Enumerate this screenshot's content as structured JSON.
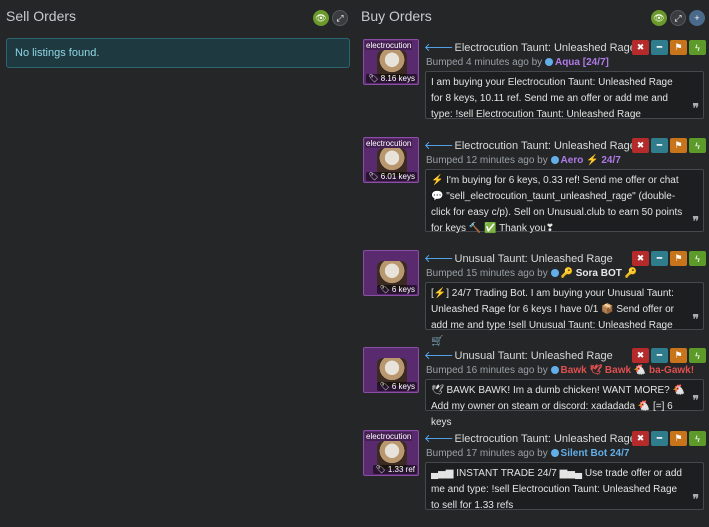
{
  "sell": {
    "title": "Sell Orders",
    "empty_message": "No listings found."
  },
  "buy": {
    "title": "Buy Orders",
    "listings": [
      {
        "effect": "electrocution",
        "name": "Electrocution Taunt: Unleashed Rage",
        "price": "8.16 keys",
        "bumped": "Bumped 4 minutes ago by",
        "user": "Aqua [24/7]",
        "user_color": "#b07ae8",
        "comment": "I am buying your Electrocution Taunt: Unleashed Rage for 8 keys, 10.11 ref. Send me an offer or add me and type: !sell Electrocution Taunt: Unleashed Rage"
      },
      {
        "effect": "electrocution",
        "name": "Electrocution Taunt: Unleashed Rage",
        "price": "6.01 keys",
        "bumped": "Bumped 12 minutes ago by",
        "user": "Aero ⚡ 24/7",
        "user_color": "#b07ae8",
        "comment": "⚡ I'm buying for 6 keys, 0.33 ref! Send me offer or chat 💬 \"sell_electrocution_taunt_unleashed_rage\" (double-click for easy c/p). Sell on Unusual.club to earn 50 points for keys 🔨 ✅ Thank you❣"
      },
      {
        "effect": "",
        "name": "Unusual Taunt: Unleashed Rage",
        "price": "6 keys",
        "bumped": "Bumped 15 minutes ago by",
        "user": "🔑 Sora BOT 🔑",
        "user_color": "#e8e8e8",
        "comment": "[⚡] 24/7 Trading Bot. I am buying your Unusual Taunt: Unleashed Rage for 6 keys I have 0/1 📦 Send offer or add me and type !sell Unusual Taunt: Unleashed Rage 🛒"
      },
      {
        "effect": "",
        "name": "Unusual Taunt: Unleashed Rage",
        "price": "6 keys",
        "bumped": "Bumped 16 minutes ago by",
        "user": "Bawk 🕊 Bawk 🐔 ba-Gawk!",
        "user_color": "#e05050",
        "comment": "🕊 BAWK BAWK! Im a dumb chicken! WANT MORE? 🐔 Add my owner on steam or discord: xadadada 🐔 [=] 6 keys"
      },
      {
        "effect": "electrocution",
        "name": "Electrocution Taunt: Unleashed Rage",
        "price": "1.33 ref",
        "bumped": "Bumped 17 minutes ago by",
        "user": "Silent Bot 24/7",
        "user_color": "#62aee8",
        "comment": "▄▅▆ INSTANT TRADE 24/7 ▆▅▄ Use trade offer or add me and type: !sell Electrocution Taunt: Unleashed Rage to sell for 1.33 refs"
      }
    ]
  },
  "icons": {
    "visibility": "eye-icon",
    "expand": "expand-icon",
    "add": "plus-icon",
    "remove": "x-icon",
    "minus": "minus-icon",
    "flag": "flag-icon",
    "bolt": "bolt-icon",
    "quote": "quote-icon",
    "arrow": "arrow-left-icon",
    "dot": "status-dot-icon",
    "tag": "tag-icon"
  }
}
